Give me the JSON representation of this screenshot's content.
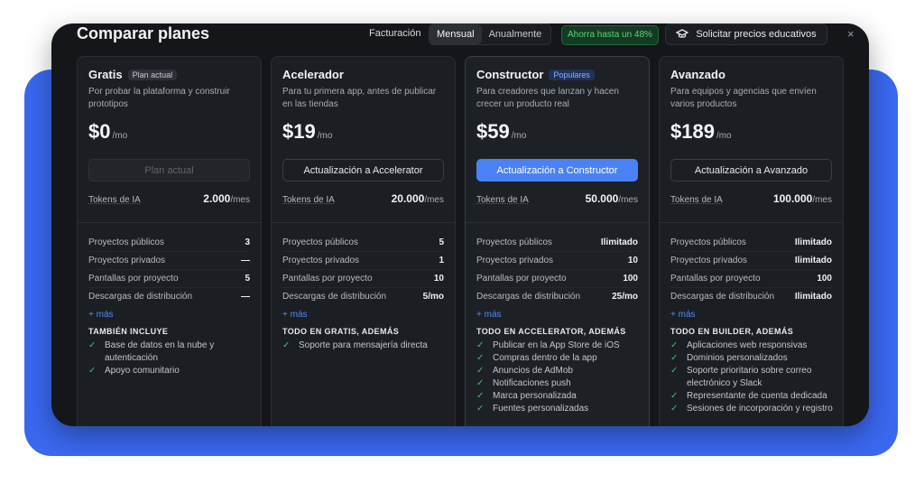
{
  "modal": {
    "title": "Comparar planes",
    "billing_label": "Facturación",
    "billing_options": [
      "Mensual",
      "Anualmente"
    ],
    "savings_badge": "Ahorra hasta un 48%",
    "edu_button": "Solicitar precios educativos",
    "edu_icon": "graduation-cap-icon",
    "close_glyph": "×"
  },
  "colors": {
    "accent": "#4a82f5",
    "success": "#3fbf68",
    "background": "#3a68f0"
  },
  "plans": [
    {
      "name": "Gratis",
      "badge": "Plan actual",
      "description": "Por probar la plataforma y construir prototipos",
      "price": "$0",
      "per": "/mo",
      "cta": "Plan actual",
      "tokens_label": "Tokens de IA",
      "tokens_value": "2.000",
      "tokens_unit": "/mes",
      "features": [
        {
          "label": "Proyectos públicos",
          "value": "3"
        },
        {
          "label": "Proyectos privados",
          "value": "—"
        },
        {
          "label": "Pantallas por proyecto",
          "value": "5"
        },
        {
          "label": "Descargas de distribución",
          "value": "—"
        }
      ],
      "more": "+ más",
      "includes_heading": "TAMBIÉN INCLUYE",
      "includes": [
        "Base de datos en la nube y autenticación",
        "Apoyo comunitario"
      ]
    },
    {
      "name": "Acelerador",
      "badge": "",
      "description": "Para tu primera app, antes de publicar en las tiendas",
      "price": "$19",
      "per": "/mo",
      "cta": "Actualización a Accelerator",
      "tokens_label": "Tokens de IA",
      "tokens_value": "20.000",
      "tokens_unit": "/mes",
      "features": [
        {
          "label": "Proyectos públicos",
          "value": "5"
        },
        {
          "label": "Proyectos privados",
          "value": "1"
        },
        {
          "label": "Pantallas por proyecto",
          "value": "10"
        },
        {
          "label": "Descargas de distribución",
          "value": "5/mo"
        }
      ],
      "more": "+ más",
      "includes_heading": "TODO EN GRATIS, ADEMÁS",
      "includes": [
        "Soporte para mensajería directa"
      ]
    },
    {
      "name": "Constructor",
      "badge": "Populares",
      "description": "Para creadores que lanzan y hacen crecer un producto real",
      "price": "$59",
      "per": "/mo",
      "cta": "Actualización a Constructor",
      "tokens_label": "Tokens de IA",
      "tokens_value": "50.000",
      "tokens_unit": "/mes",
      "features": [
        {
          "label": "Proyectos públicos",
          "value": "Ilimitado"
        },
        {
          "label": "Proyectos privados",
          "value": "10"
        },
        {
          "label": "Pantallas por proyecto",
          "value": "100"
        },
        {
          "label": "Descargas de distribución",
          "value": "25/mo"
        }
      ],
      "more": "+ más",
      "includes_heading": "TODO EN ACCELERATOR, ADEMÁS",
      "includes": [
        "Publicar en la App Store de iOS",
        "Compras dentro de la app",
        "Anuncios de AdMob",
        "Notificaciones push",
        "Marca personalizada",
        "Fuentes personalizadas"
      ]
    },
    {
      "name": "Avanzado",
      "badge": "",
      "description": "Para equipos y agencias que envíen varios productos",
      "price": "$189",
      "per": "/mo",
      "cta": "Actualización a Avanzado",
      "tokens_label": "Tokens de IA",
      "tokens_value": "100.000",
      "tokens_unit": "/mes",
      "features": [
        {
          "label": "Proyectos públicos",
          "value": "Ilimitado"
        },
        {
          "label": "Proyectos privados",
          "value": "Ilimitado"
        },
        {
          "label": "Pantallas por proyecto",
          "value": "100"
        },
        {
          "label": "Descargas de distribución",
          "value": "Ilimitado"
        }
      ],
      "more": "+ más",
      "includes_heading": "TODO EN BUILDER, ADEMÁS",
      "includes": [
        "Aplicaciones web responsivas",
        "Dominios personalizados",
        "Soporte prioritario sobre correo electrónico y Slack",
        "Representante de cuenta dedicada",
        "Sesiones de incorporación y registro"
      ]
    }
  ]
}
